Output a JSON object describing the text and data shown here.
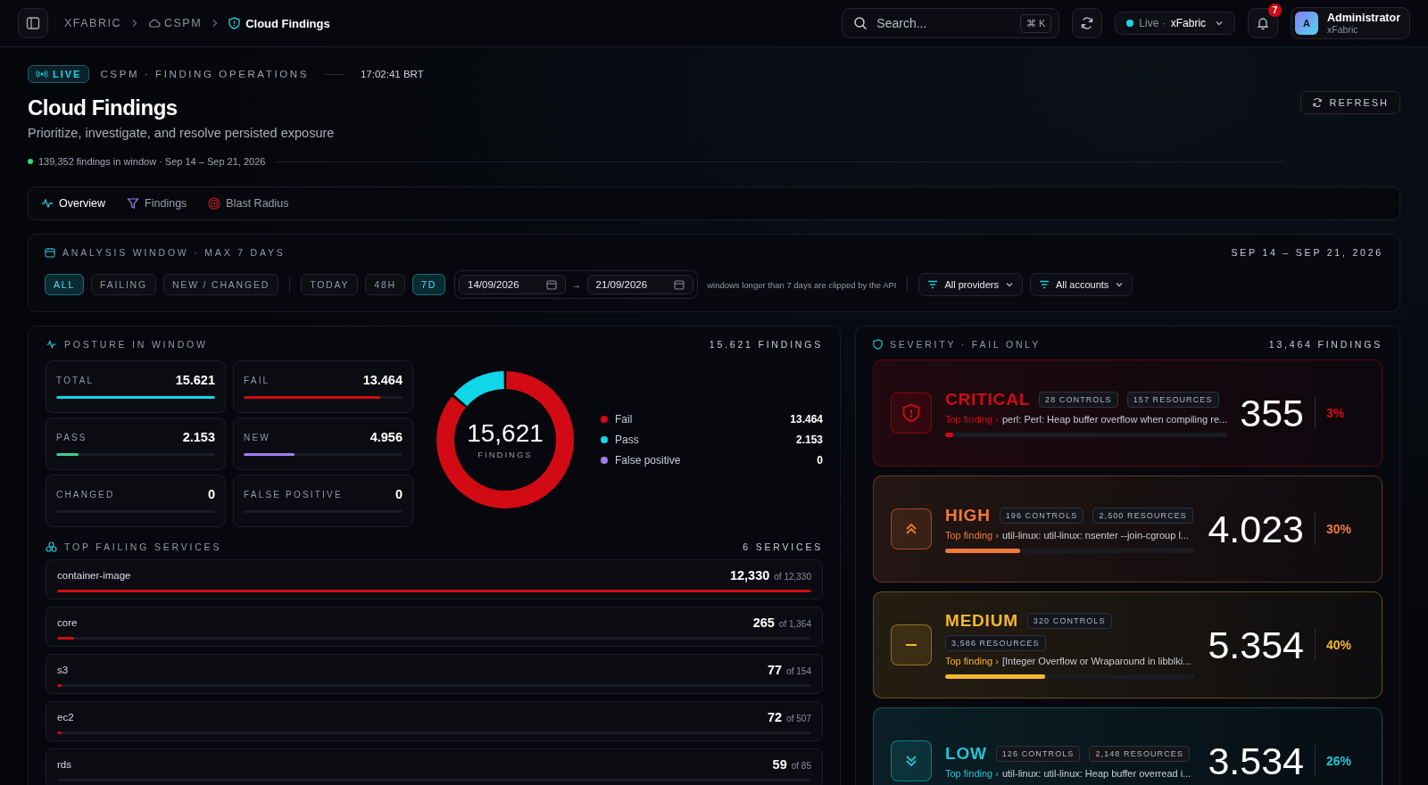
{
  "topbar": {
    "breadcrumbs": [
      {
        "label": "XFABRIC",
        "kind": "plain"
      },
      {
        "label": "CSPM",
        "kind": "cloud"
      },
      {
        "label": "Cloud Findings",
        "kind": "current"
      }
    ],
    "search": {
      "placeholder": "Search...",
      "shortcut": "⌘ K"
    },
    "environment": {
      "status": "Live ·",
      "name": "xFabric"
    },
    "notifications": {
      "count": "7"
    },
    "user": {
      "initial": "A",
      "name": "Administrator",
      "org": "xFabric"
    }
  },
  "header": {
    "live_badge": "LIVE",
    "eyebrow": "CSPM · FINDING OPERATIONS",
    "time": "17:02:41 BRT",
    "title": "Cloud Findings",
    "subtitle": "Prioritize, investigate, and resolve persisted exposure",
    "summary": "139,352 findings in window · Sep 14 – Sep 21, 2026",
    "refresh": "REFRESH"
  },
  "tabs": [
    {
      "label": "Overview",
      "kind": "pulse",
      "selected": true
    },
    {
      "label": "Findings",
      "kind": "filter",
      "selected": false
    },
    {
      "label": "Blast Radius",
      "kind": "radar",
      "selected": false
    }
  ],
  "analysis_window": {
    "title": "ANALYSIS WINDOW · MAX 7 DAYS",
    "range": "SEP 14 – SEP 21, 2026",
    "scopes": [
      {
        "label": "ALL",
        "selected": true
      },
      {
        "label": "FAILING",
        "selected": false
      },
      {
        "label": "NEW / CHANGED",
        "selected": false
      }
    ],
    "periods": [
      {
        "label": "TODAY",
        "selected": false
      },
      {
        "label": "48H",
        "selected": false
      },
      {
        "label": "7D",
        "selected": true
      }
    ],
    "date_from": "14/09/2026",
    "date_to": "21/09/2026",
    "arrow": "→",
    "note": "windows longer than 7 days are clipped by the API",
    "providers": "All providers",
    "accounts": "All accounts"
  },
  "posture": {
    "title": "POSTURE IN WINDOW",
    "count": "15.621 FINDINGS",
    "stats": [
      {
        "label": "TOTAL",
        "value": "15.621",
        "level": 1,
        "color": "#0fd6e8"
      },
      {
        "label": "FAIL",
        "value": "13.464",
        "level": 0.86,
        "color": "#d10a14"
      },
      {
        "label": "PASS",
        "value": "2.153",
        "level": 0.14,
        "color": "#3fcf8e"
      },
      {
        "label": "NEW",
        "value": "4.956",
        "level": 0.32,
        "color": "#a47cf0"
      },
      {
        "label": "CHANGED",
        "value": "0"
      },
      {
        "label": "FALSE POSITIVE",
        "value": "0"
      }
    ],
    "donut": {
      "center_value": "15,621",
      "center_label": "FINDINGS",
      "chart_data": {
        "type": "donut",
        "categories": [
          "Fail",
          "Pass",
          "False positive"
        ],
        "values": [
          13.464,
          2.153,
          0
        ],
        "colors": [
          "#d10a14",
          "#0fd6e8",
          "#a47cf0"
        ],
        "value_labels": [
          "13.464",
          "2.153",
          "0"
        ],
        "legend": "right"
      }
    }
  },
  "services": {
    "title": "TOP FAILING SERVICES",
    "count": "6 SERVICES",
    "rows": [
      {
        "name": "container-image",
        "value": "12,330",
        "total": "of 12,330",
        "level": 1
      },
      {
        "name": "core",
        "value": "265",
        "total": "of 1,364",
        "level": 0.022
      },
      {
        "name": "s3",
        "value": "77",
        "total": "of 154",
        "level": 0.006
      },
      {
        "name": "ec2",
        "value": "72",
        "total": "of 507",
        "level": 0.006
      },
      {
        "name": "rds",
        "value": "59",
        "total": "of 85"
      }
    ]
  },
  "severity": {
    "title": "SEVERITY · FAIL ONLY",
    "count": "13,464 FINDINGS",
    "cards": [
      {
        "kind": "critical",
        "label": "CRITICAL",
        "controls": "28 CONTROLS",
        "resources": "157 RESOURCES",
        "top_label": "Top finding ›",
        "top_finding": "perl: Perl: Heap buffer overflow when compiling re...",
        "level": 0.03,
        "value": "355",
        "percent": "3%",
        "color": "#d10a14"
      },
      {
        "kind": "high",
        "label": "HIGH",
        "controls": "196 CONTROLS",
        "resources": "2,500 RESOURCES",
        "top_label": "Top finding ›",
        "top_finding": "util-linux: util-linux: nsenter --join-cgroup l...",
        "level": 0.3,
        "value": "4.023",
        "percent": "30%",
        "color": "#f07a3a"
      },
      {
        "kind": "medium",
        "label": "MEDIUM",
        "controls": "320 CONTROLS",
        "resources": "3,586 RESOURCES",
        "top_label": "Top finding ›",
        "top_finding": "[Integer Overflow or Wraparound in libblki...",
        "level": 0.4,
        "value": "5.354",
        "percent": "40%",
        "color": "#f5b62e"
      },
      {
        "kind": "low",
        "label": "LOW",
        "controls": "126 CONTROLS",
        "resources": "2,148 RESOURCES",
        "top_label": "Top finding ›",
        "top_finding": "util-linux: util-linux: Heap buffer overread i...",
        "value": "3.534",
        "percent": "26%",
        "color": "#22c4d4"
      }
    ]
  }
}
